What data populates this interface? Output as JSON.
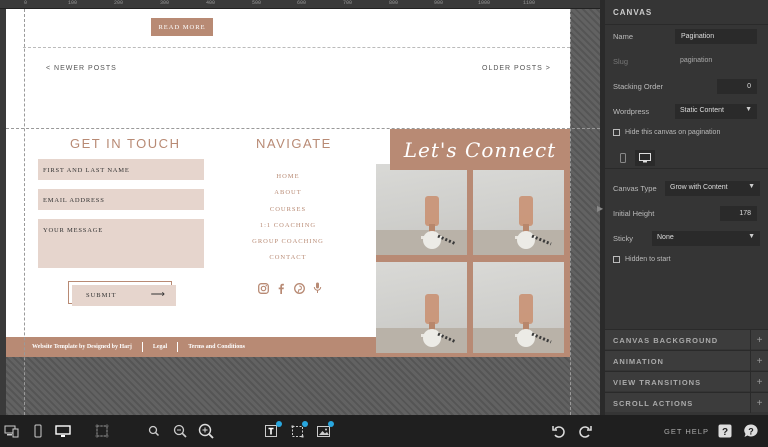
{
  "canvas_page": {
    "read_more": "READ MORE",
    "newer_posts": "< NEWER POSTS",
    "older_posts": "OLDER POSTS >",
    "get_in_touch": "GET IN TOUCH",
    "navigate": "NAVIGATE",
    "lets_connect": "Let's Connect",
    "fields": {
      "name": "FIRST AND LAST NAME",
      "email": "EMAIL ADDRESS",
      "message": "YOUR MESSAGE"
    },
    "submit": "SUBMIT",
    "submit_arrow": "⟶",
    "nav_items": [
      "HOME",
      "ABOUT",
      "COURSES",
      "1:1 COACHING",
      "GROUP COACHING",
      "CONTACT"
    ],
    "social_icons": [
      "instagram-icon",
      "facebook-icon",
      "pinterest-icon",
      "microphone-icon"
    ],
    "footer_links": [
      "Website Template by Designed by Harj",
      "Legal",
      "Terms and Conditions"
    ]
  },
  "ruler": {
    "marks": [
      "0",
      "100",
      "200",
      "300",
      "400",
      "500",
      "600",
      "700",
      "800",
      "900",
      "1000",
      "1100"
    ]
  },
  "panel": {
    "header": "CANVAS",
    "name_label": "Name",
    "name_value": "Pagination",
    "slug_label": "Slug",
    "slug_value": "pagination",
    "stacking_label": "Stacking Order",
    "stacking_value": "0",
    "wordpress_label": "Wordpress",
    "wordpress_value": "Static Content",
    "hide_pagination": "Hide this canvas on pagination",
    "canvas_type_label": "Canvas Type",
    "canvas_type_value": "Grow with Content",
    "initial_height_label": "Initial Height",
    "initial_height_value": "178",
    "sticky_label": "Sticky",
    "sticky_value": "None",
    "hidden_to_start": "Hidden to start",
    "sections": [
      "CANVAS BACKGROUND",
      "ANIMATION",
      "VIEW TRANSITIONS",
      "SCROLL ACTIONS"
    ]
  },
  "toolbar": {
    "get_help": "GET HELP"
  },
  "colors": {
    "brand": "#b88a74",
    "brand_light": "#e6d5cd",
    "panel_bg": "#353535",
    "accent": "#29a7df"
  }
}
